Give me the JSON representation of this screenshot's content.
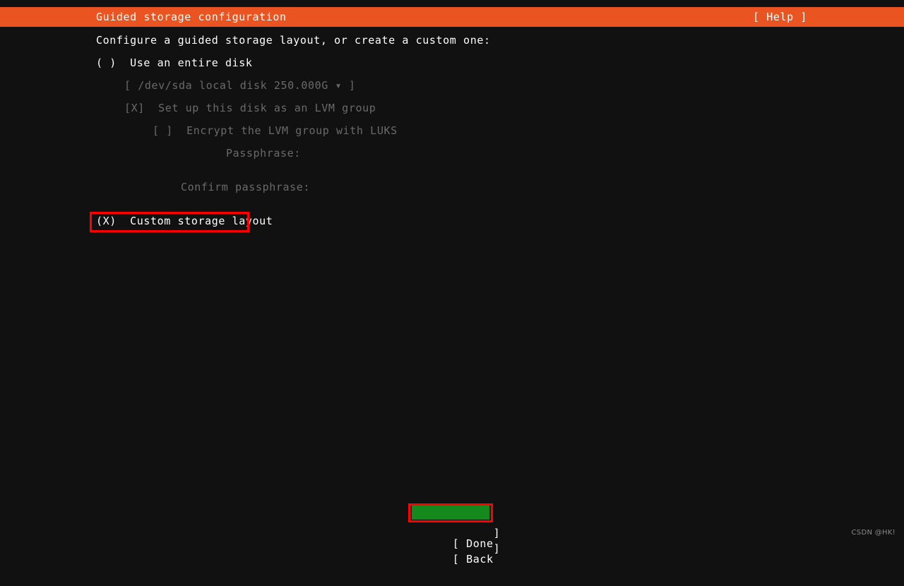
{
  "header": {
    "title": "Guided storage configuration",
    "help_label": "[ Help ]",
    "background_color": "#e95420",
    "text_color": "#ffffff"
  },
  "screen": {
    "background_color": "#111111",
    "dim_text_color": "#6a6a6a",
    "text_color": "#ffffff"
  },
  "main": {
    "intro": "Configure a guided storage layout, or create a custom one:",
    "option_entire_disk": "( )  Use an entire disk",
    "disk_selector": "[ /dev/sda local disk 250.000G ▾ ]",
    "lvm_checkbox": "[X]  Set up this disk as an LVM group",
    "luks_checkbox": "[ ]  Encrypt the LVM group with LUKS",
    "passphrase_label": "Passphrase:",
    "confirm_passphrase_label": "Confirm passphrase:",
    "option_custom_layout": "(X)  Custom storage layout"
  },
  "footer": {
    "done_open_bracket": "[",
    "done_label": " Done",
    "done_close_bracket": "]",
    "back_open_bracket": "[",
    "back_label": " Back",
    "back_close_bracket": "]",
    "done_background_color": "#16891d"
  },
  "annotations": {
    "highlight_color": "#ff0000",
    "custom_layout_box": "highlight-custom-storage-layout",
    "done_button_box": "highlight-done-button"
  },
  "watermark": {
    "text": "CSDN @HK!"
  }
}
